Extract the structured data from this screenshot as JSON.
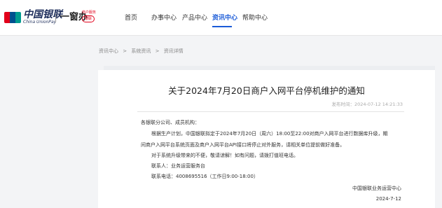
{
  "header": {
    "logo": {
      "cn": "中国银联",
      "en": "China UnionPay",
      "card_colors": [
        "#e2001a",
        "#00508f",
        "#009b8f"
      ]
    },
    "brand": "一窗办",
    "badge_small": "商户服务",
    "badge_text": "银联",
    "nav": [
      "首页",
      "办事中心",
      "产品中心",
      "资讯中心",
      "帮助中心"
    ],
    "active_nav": "资讯中心",
    "accent": "#1a5bd8"
  },
  "breadcrumb": [
    "资讯中心",
    "系统资讯",
    "资讯详情"
  ],
  "breadcrumb_sep": ">",
  "article": {
    "title": "关于2024年7月20日商户入网平台停机维护的通知",
    "date_label": "发布时间：2024-07-12 14:21:33",
    "greeting": "各银联分公司、成员机构：",
    "para1_line1": "根据生产计划，中国银联拟定于2024年7月20日（周六）18:00至22:00对商户入网平台进行数据库升级，期",
    "para1_line2": "间商户入网平台系统页面及商户入网平台API接口将停止对外服务，请相关单位提前做好准备。",
    "para2": "对于系统升级带来的不便，敬请谅解！如有问题，请拨打值班电话。",
    "contact_person": "联系人：业务运营服务台",
    "contact_phone": "联系电话：4008695516（工作日9:00-18:00）",
    "signature_org": "中国银联业务运营中心",
    "signature_date": "2024-7-12"
  }
}
